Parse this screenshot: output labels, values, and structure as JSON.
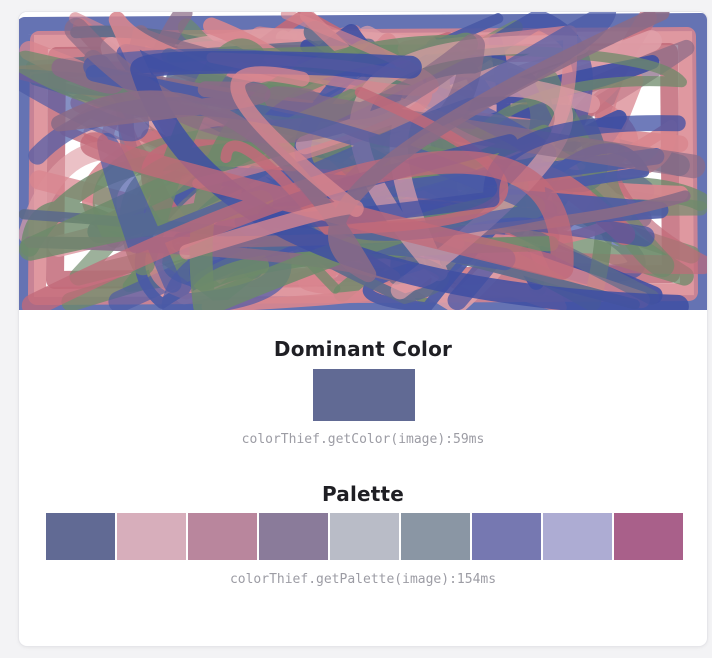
{
  "image": {
    "alt_icon": "abstract-scribble-painting",
    "background": "#ffffff",
    "stroke_colors": [
      "#4a5aa6",
      "#d9868f",
      "#c26a79",
      "#5c6b8a",
      "#6d8a6a",
      "#3f4fa3",
      "#e0a0a8",
      "#8a6b86"
    ]
  },
  "dominant": {
    "title": "Dominant Color",
    "color": "#616a94",
    "timing": "colorThief.getColor(image):59ms"
  },
  "palette": {
    "title": "Palette",
    "colors": [
      "#616a94",
      "#d7aebb",
      "#b9869d",
      "#8a7b9a",
      "#b9bcc7",
      "#8a96a4",
      "#7678b1",
      "#adacd3",
      "#a9608a"
    ],
    "timing": "colorThief.getPalette(image):154ms"
  }
}
